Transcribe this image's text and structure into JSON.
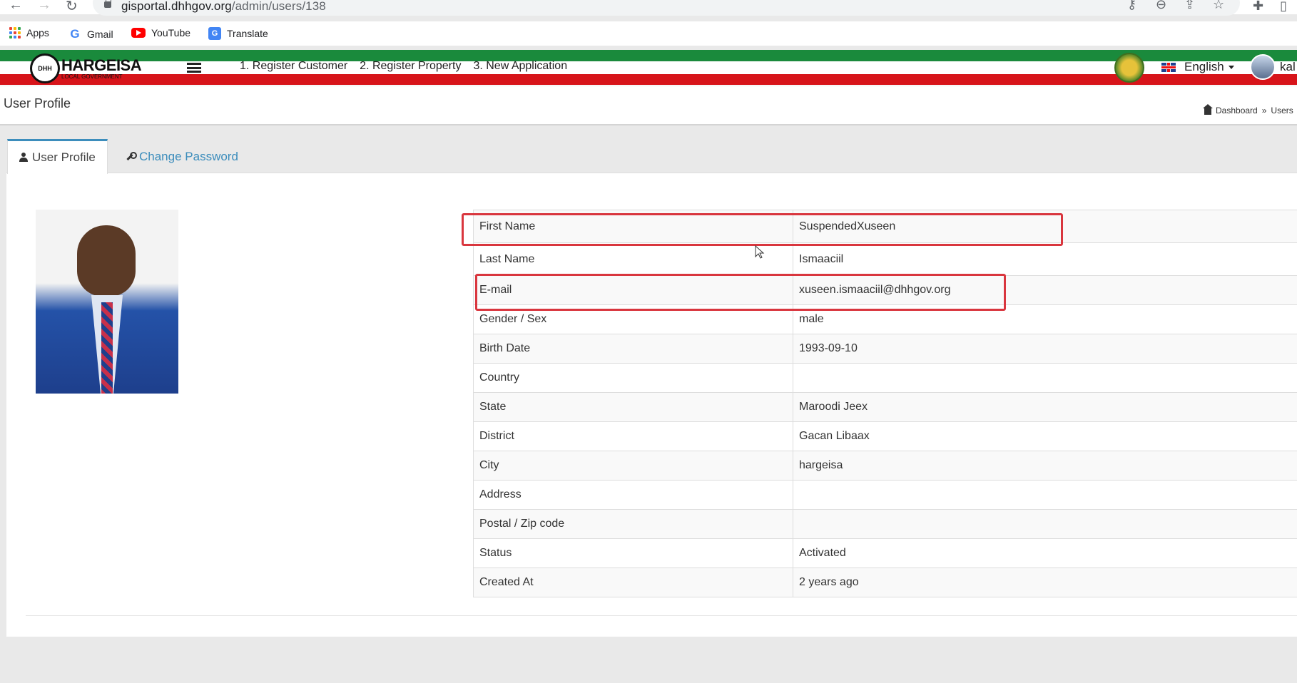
{
  "browser": {
    "url_host": "gisportal.dhhgov.org",
    "url_path": "/admin/users/138",
    "bookmarks": [
      {
        "label": "Apps",
        "icon": "apps-grid-icon"
      },
      {
        "label": "Gmail",
        "icon": "google-icon"
      },
      {
        "label": "YouTube",
        "icon": "youtube-icon"
      },
      {
        "label": "Translate",
        "icon": "translate-icon"
      }
    ]
  },
  "header": {
    "logo_title": "HARGEISA",
    "logo_subtitle": "LOCAL GOVERNMENT",
    "logo_mark": "DHH",
    "nav": [
      "1. Register Customer",
      "2. Register Property",
      "3. New Application"
    ],
    "language": "English",
    "user_name": "kal",
    "colors": {
      "green": "#1a8a3c",
      "red": "#d7141a",
      "accent": "#3c8dbc"
    }
  },
  "page": {
    "title": "User Profile",
    "breadcrumb": {
      "home": "Dashboard",
      "separator": "»",
      "current": "Users"
    }
  },
  "tabs": [
    {
      "label": "User Profile",
      "icon": "user-icon",
      "active": true
    },
    {
      "label": "Change Password",
      "icon": "wrench-icon",
      "active": false
    }
  ],
  "profile": {
    "rows": [
      {
        "label": "First Name",
        "value": "SuspendedXuseen"
      },
      {
        "label": "Last Name",
        "value": "Ismaaciil"
      },
      {
        "label": "E-mail",
        "value": "xuseen.ismaaciil@dhhgov.org"
      },
      {
        "label": "Gender / Sex",
        "value": "male"
      },
      {
        "label": "Birth Date",
        "value": "1993-09-10"
      },
      {
        "label": "Country",
        "value": ""
      },
      {
        "label": "State",
        "value": "Maroodi Jeex"
      },
      {
        "label": "District",
        "value": "Gacan Libaax"
      },
      {
        "label": "City",
        "value": "hargeisa"
      },
      {
        "label": "Address",
        "value": ""
      },
      {
        "label": "Postal / Zip code",
        "value": ""
      },
      {
        "label": "Status",
        "value": "Activated"
      },
      {
        "label": "Created At",
        "value": "2 years ago"
      }
    ]
  }
}
